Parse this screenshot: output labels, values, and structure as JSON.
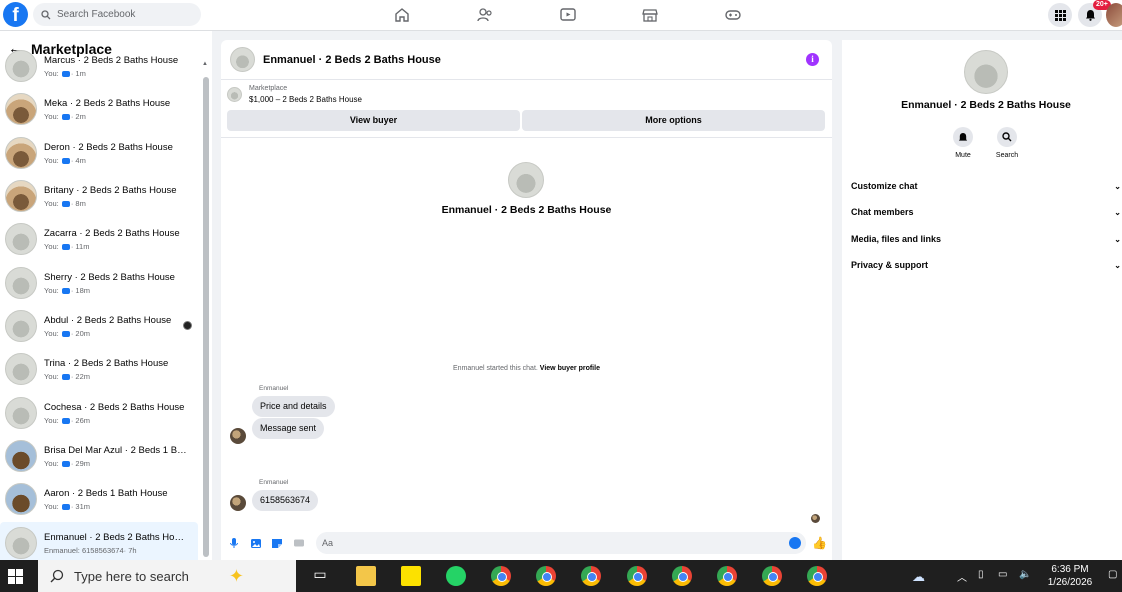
{
  "topbar": {
    "logo": "f",
    "search_placeholder": "Search Facebook",
    "icons": [
      "home-icon",
      "friends-icon",
      "watch-icon",
      "marketplace-icon",
      "gaming-icon"
    ],
    "right_icons": [
      "menu-grid-icon",
      "bell-icon",
      "profile-avatar"
    ],
    "notification_count": "20+"
  },
  "sidebar": {
    "title": "Marketplace",
    "back": "←",
    "conversations": [
      {
        "name": "Marcus · 2 Beds 2 Baths House",
        "sub": "You: ",
        "time": "· 1m",
        "thumb": "interior"
      },
      {
        "name": "Meka · 2 Beds 2 Baths House",
        "sub": "You: ",
        "time": "· 2m",
        "thumb": "brown"
      },
      {
        "name": "Deron · 2 Beds 2 Baths House",
        "sub": "You: ",
        "time": "· 4m",
        "thumb": "brown"
      },
      {
        "name": "Britany · 2 Beds 2 Baths House",
        "sub": "You: ",
        "time": "· 8m",
        "thumb": "brown"
      },
      {
        "name": "Zacarra · 2 Beds 2 Baths House",
        "sub": "You: ",
        "time": "· 11m",
        "thumb": "interior"
      },
      {
        "name": "Sherry · 2 Beds 2 Baths House",
        "sub": "You: ",
        "time": "· 18m",
        "thumb": "interior"
      },
      {
        "name": "Abdul · 2 Beds 2 Baths House",
        "sub": "You: ",
        "time": "· 20m",
        "thumb": "interior"
      },
      {
        "name": "Trina · 2 Beds 2 Baths House",
        "sub": "You: ",
        "time": "· 22m",
        "thumb": "interior"
      },
      {
        "name": "Cochesa · 2 Beds 2 Baths House",
        "sub": "You: ",
        "time": "· 26m",
        "thumb": "interior"
      },
      {
        "name": "Brisa Del Mar Azul · 2 Beds 1 Bat...",
        "sub": "You: ",
        "time": "· 29m",
        "thumb": "house"
      },
      {
        "name": "Aaron · 2 Beds 1 Bath House",
        "sub": "You: ",
        "time": "· 31m",
        "thumb": "house"
      },
      {
        "name": "Enmanuel · 2 Beds 2 Baths House",
        "sub": "Enmanuel: 6158563674",
        "time": "· 7h",
        "thumb": "interior"
      }
    ]
  },
  "chat": {
    "title": "Enmanuel · 2 Beds 2 Baths House",
    "marketplace_label": "Marketplace",
    "listing": "$1,000 – 2 Beds 2 Baths House",
    "view_buyer": "View buyer",
    "more_options": "More options",
    "center_name": "Enmanuel · 2 Beds 2 Baths House",
    "started_text": "Enmanuel started this chat.",
    "started_link": "View buyer profile",
    "messages": [
      {
        "sender": "Enmanuel",
        "text": "Price and details"
      },
      {
        "sender": "",
        "text": "Message sent"
      },
      {
        "sender": "Enmanuel",
        "text": "6158563674"
      }
    ],
    "composer_placeholder": "Aa"
  },
  "details": {
    "name": "Enmanuel · 2 Beds 2 Baths House",
    "actions": [
      {
        "label": "Mute",
        "icon": "bell-icon"
      },
      {
        "label": "Search",
        "icon": "search-icon"
      }
    ],
    "sections": [
      "Customize chat",
      "Chat members",
      "Media, files and links",
      "Privacy & support"
    ]
  },
  "taskbar": {
    "search_placeholder": "Type here to search",
    "time": "6:36 PM",
    "date": "1/26/2026"
  },
  "colors": {
    "brand": "#1877f2",
    "info": "#a033ff",
    "taskbar": "#1f1f1f"
  }
}
